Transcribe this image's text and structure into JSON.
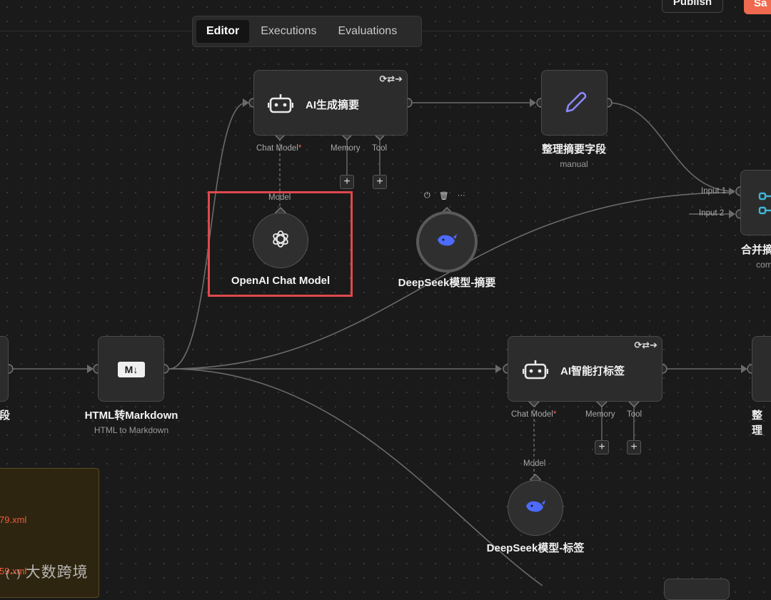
{
  "header": {
    "tabs": [
      {
        "label": "Editor",
        "active": true
      },
      {
        "label": "Executions",
        "active": false
      },
      {
        "label": "Evaluations",
        "active": false
      }
    ],
    "publish_label": "Publish",
    "save_label": "Sa"
  },
  "nodes": {
    "ai_summary": {
      "title": "AI生成摘要",
      "ports": [
        "Chat Model",
        "Memory",
        "Tool"
      ],
      "required_mark": "*"
    },
    "organize": {
      "title": "整理摘要字段",
      "subtitle": "manual"
    },
    "merge": {
      "title": "合并摘",
      "subtitle": "com",
      "inputs": [
        "Input 1",
        "Input 2"
      ]
    },
    "openai": {
      "title": "OpenAI Chat Model",
      "port": "Model"
    },
    "deepseek_summary": {
      "title": "DeepSeek模型-摘要"
    },
    "html_md": {
      "title": "HTML转Markdown",
      "subtitle": "HTML to Markdown",
      "icon_text": "M↓"
    },
    "left_partial": {
      "title": "段"
    },
    "ai_tag": {
      "title": "AI智能打标签",
      "ports": [
        "Chat Model",
        "Memory",
        "Tool"
      ],
      "required_mark": "*"
    },
    "deepseek_tag": {
      "title": "DeepSeek模型-标签",
      "port": "Model"
    },
    "right_partial": {
      "title": "整理"
    }
  },
  "sticky": {
    "line1": "79.xml",
    "line2": "59.xml"
  },
  "watermark": "大数跨境",
  "colors": {
    "accent": "#ef6a4e",
    "highlight": "#e0484c",
    "deepseek": "#4d6bfe",
    "edit": "#8b86ff"
  }
}
